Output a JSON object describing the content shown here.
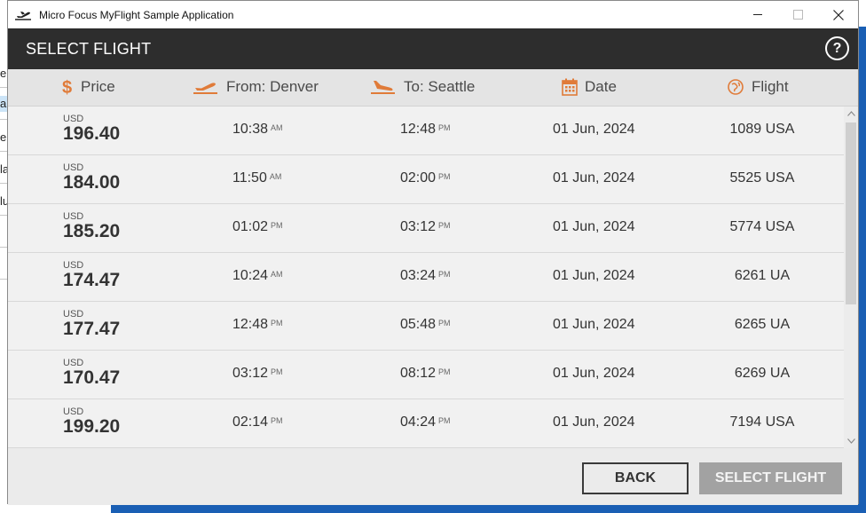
{
  "window": {
    "title": "Micro Focus MyFlight Sample Application",
    "app_icon": "airplane-takeoff-icon",
    "controls": [
      "minimize-icon",
      "maximize-icon",
      "close-icon"
    ]
  },
  "header": {
    "title": "SELECT FLIGHT",
    "help_label": "?"
  },
  "columns": {
    "price": "Price",
    "from": "From: Denver",
    "to": "To: Seattle",
    "date": "Date",
    "flight": "Flight"
  },
  "flights": [
    {
      "currency": "USD",
      "price": "196.40",
      "dep_time": "10:38",
      "dep_ampm": "AM",
      "arr_time": "12:48",
      "arr_ampm": "PM",
      "date": "01 Jun, 2024",
      "flight": "1089 USA"
    },
    {
      "currency": "USD",
      "price": "184.00",
      "dep_time": "11:50",
      "dep_ampm": "AM",
      "arr_time": "02:00",
      "arr_ampm": "PM",
      "date": "01 Jun, 2024",
      "flight": "5525 USA"
    },
    {
      "currency": "USD",
      "price": "185.20",
      "dep_time": "01:02",
      "dep_ampm": "PM",
      "arr_time": "03:12",
      "arr_ampm": "PM",
      "date": "01 Jun, 2024",
      "flight": "5774 USA"
    },
    {
      "currency": "USD",
      "price": "174.47",
      "dep_time": "10:24",
      "dep_ampm": "AM",
      "arr_time": "03:24",
      "arr_ampm": "PM",
      "date": "01 Jun, 2024",
      "flight": "6261 UA"
    },
    {
      "currency": "USD",
      "price": "177.47",
      "dep_time": "12:48",
      "dep_ampm": "PM",
      "arr_time": "05:48",
      "arr_ampm": "PM",
      "date": "01 Jun, 2024",
      "flight": "6265 UA"
    },
    {
      "currency": "USD",
      "price": "170.47",
      "dep_time": "03:12",
      "dep_ampm": "PM",
      "arr_time": "08:12",
      "arr_ampm": "PM",
      "date": "01 Jun, 2024",
      "flight": "6269 UA"
    },
    {
      "currency": "USD",
      "price": "199.20",
      "dep_time": "02:14",
      "dep_ampm": "PM",
      "arr_time": "04:24",
      "arr_ampm": "PM",
      "date": "01 Jun, 2024",
      "flight": "7194 USA"
    }
  ],
  "footer": {
    "back_label": "BACK",
    "select_label": "SELECT FLIGHT"
  },
  "background_window": {
    "cells": [
      "e",
      "ar",
      "e",
      "la",
      "lu"
    ]
  },
  "colors": {
    "accent": "#e07b39",
    "header_bg": "#2d2d2d",
    "select_button_disabled": "#a2a2a2"
  }
}
